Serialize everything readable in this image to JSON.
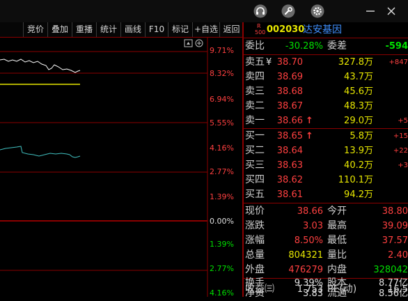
{
  "window": {
    "icons": [
      "headset-icon",
      "wrench-icon",
      "gear-icon",
      "minimize-icon",
      "close-icon"
    ]
  },
  "toolbar": {
    "buttons": [
      "竞价",
      "叠加",
      "重播",
      "统计",
      "画线",
      "F10",
      "标记",
      "+自选",
      "返回"
    ]
  },
  "chart": {
    "pct_labels": [
      "9.71%",
      "8.32%",
      "6.94%",
      "5.55%",
      "4.16%",
      "2.77%",
      "1.39%",
      "0.00%",
      "1.39%",
      "2.77%",
      "4.16%"
    ]
  },
  "stock": {
    "badge_r": "R",
    "badge_num": "500",
    "code": "002030",
    "name": "达安基因"
  },
  "weibi": {
    "label1": "委比",
    "value1": "-30.28%",
    "label2": "委差",
    "value2": "-594"
  },
  "sell": [
    {
      "label": "卖五",
      "mark": "¥",
      "price": "38.70",
      "vol": "327.8万",
      "change": "+847"
    },
    {
      "label": "卖四",
      "price": "38.69",
      "vol": "43.7万"
    },
    {
      "label": "卖三",
      "price": "38.68",
      "vol": "45.6万"
    },
    {
      "label": "卖二",
      "price": "38.67",
      "vol": "48.3万"
    },
    {
      "label": "卖一",
      "price": "38.66",
      "arrow": "↑",
      "vol": "29.0万",
      "change": "+5"
    }
  ],
  "buy": [
    {
      "label": "买一",
      "price": "38.65",
      "arrow": "↑",
      "vol": "5.8万",
      "change": "+15"
    },
    {
      "label": "买二",
      "price": "38.64",
      "vol": "13.9万",
      "change": "+22"
    },
    {
      "label": "买三",
      "price": "38.63",
      "vol": "40.2万",
      "change": "+3"
    },
    {
      "label": "买四",
      "price": "38.62",
      "vol": "110.1万"
    },
    {
      "label": "买五",
      "price": "38.61",
      "vol": "94.2万"
    }
  ],
  "quote": {
    "xianjia_label": "现价",
    "xianjia": "38.66",
    "jinkai_label": "今开",
    "jinkai": "38.80",
    "zhangdie_label": "涨跌",
    "zhangdie": "3.03",
    "zuigao_label": "最高",
    "zuigao": "39.09",
    "zhangfu_label": "涨幅",
    "zhangfu": "8.50%",
    "zuidi_label": "最低",
    "zuidi": "37.57",
    "zongliang_label": "总量",
    "zongliang": "804321",
    "liangbi_label": "量比",
    "liangbi": "2.40",
    "waipan_label": "外盘",
    "waipan": "476279",
    "neipan_label": "内盘",
    "neipan": "328042",
    "huanshou_label": "换手",
    "huanshou": "9.39%",
    "guben_label": "股本",
    "guben": "8.77亿",
    "jingzi_label": "净资",
    "jingzi": "3.83",
    "liutong_label": "流通",
    "liutong": "8.56亿",
    "shouyi_label": "收益㈢",
    "shouyi": "1.753",
    "pe_label": "PE(动)",
    "pe": "16.5"
  },
  "colors": {
    "up": "#ff4040",
    "down": "#00e000",
    "grid": "#8b0000",
    "price_line": "#ffffff",
    "avg_line": "#e8e800",
    "index_line": "#40c0c0"
  }
}
